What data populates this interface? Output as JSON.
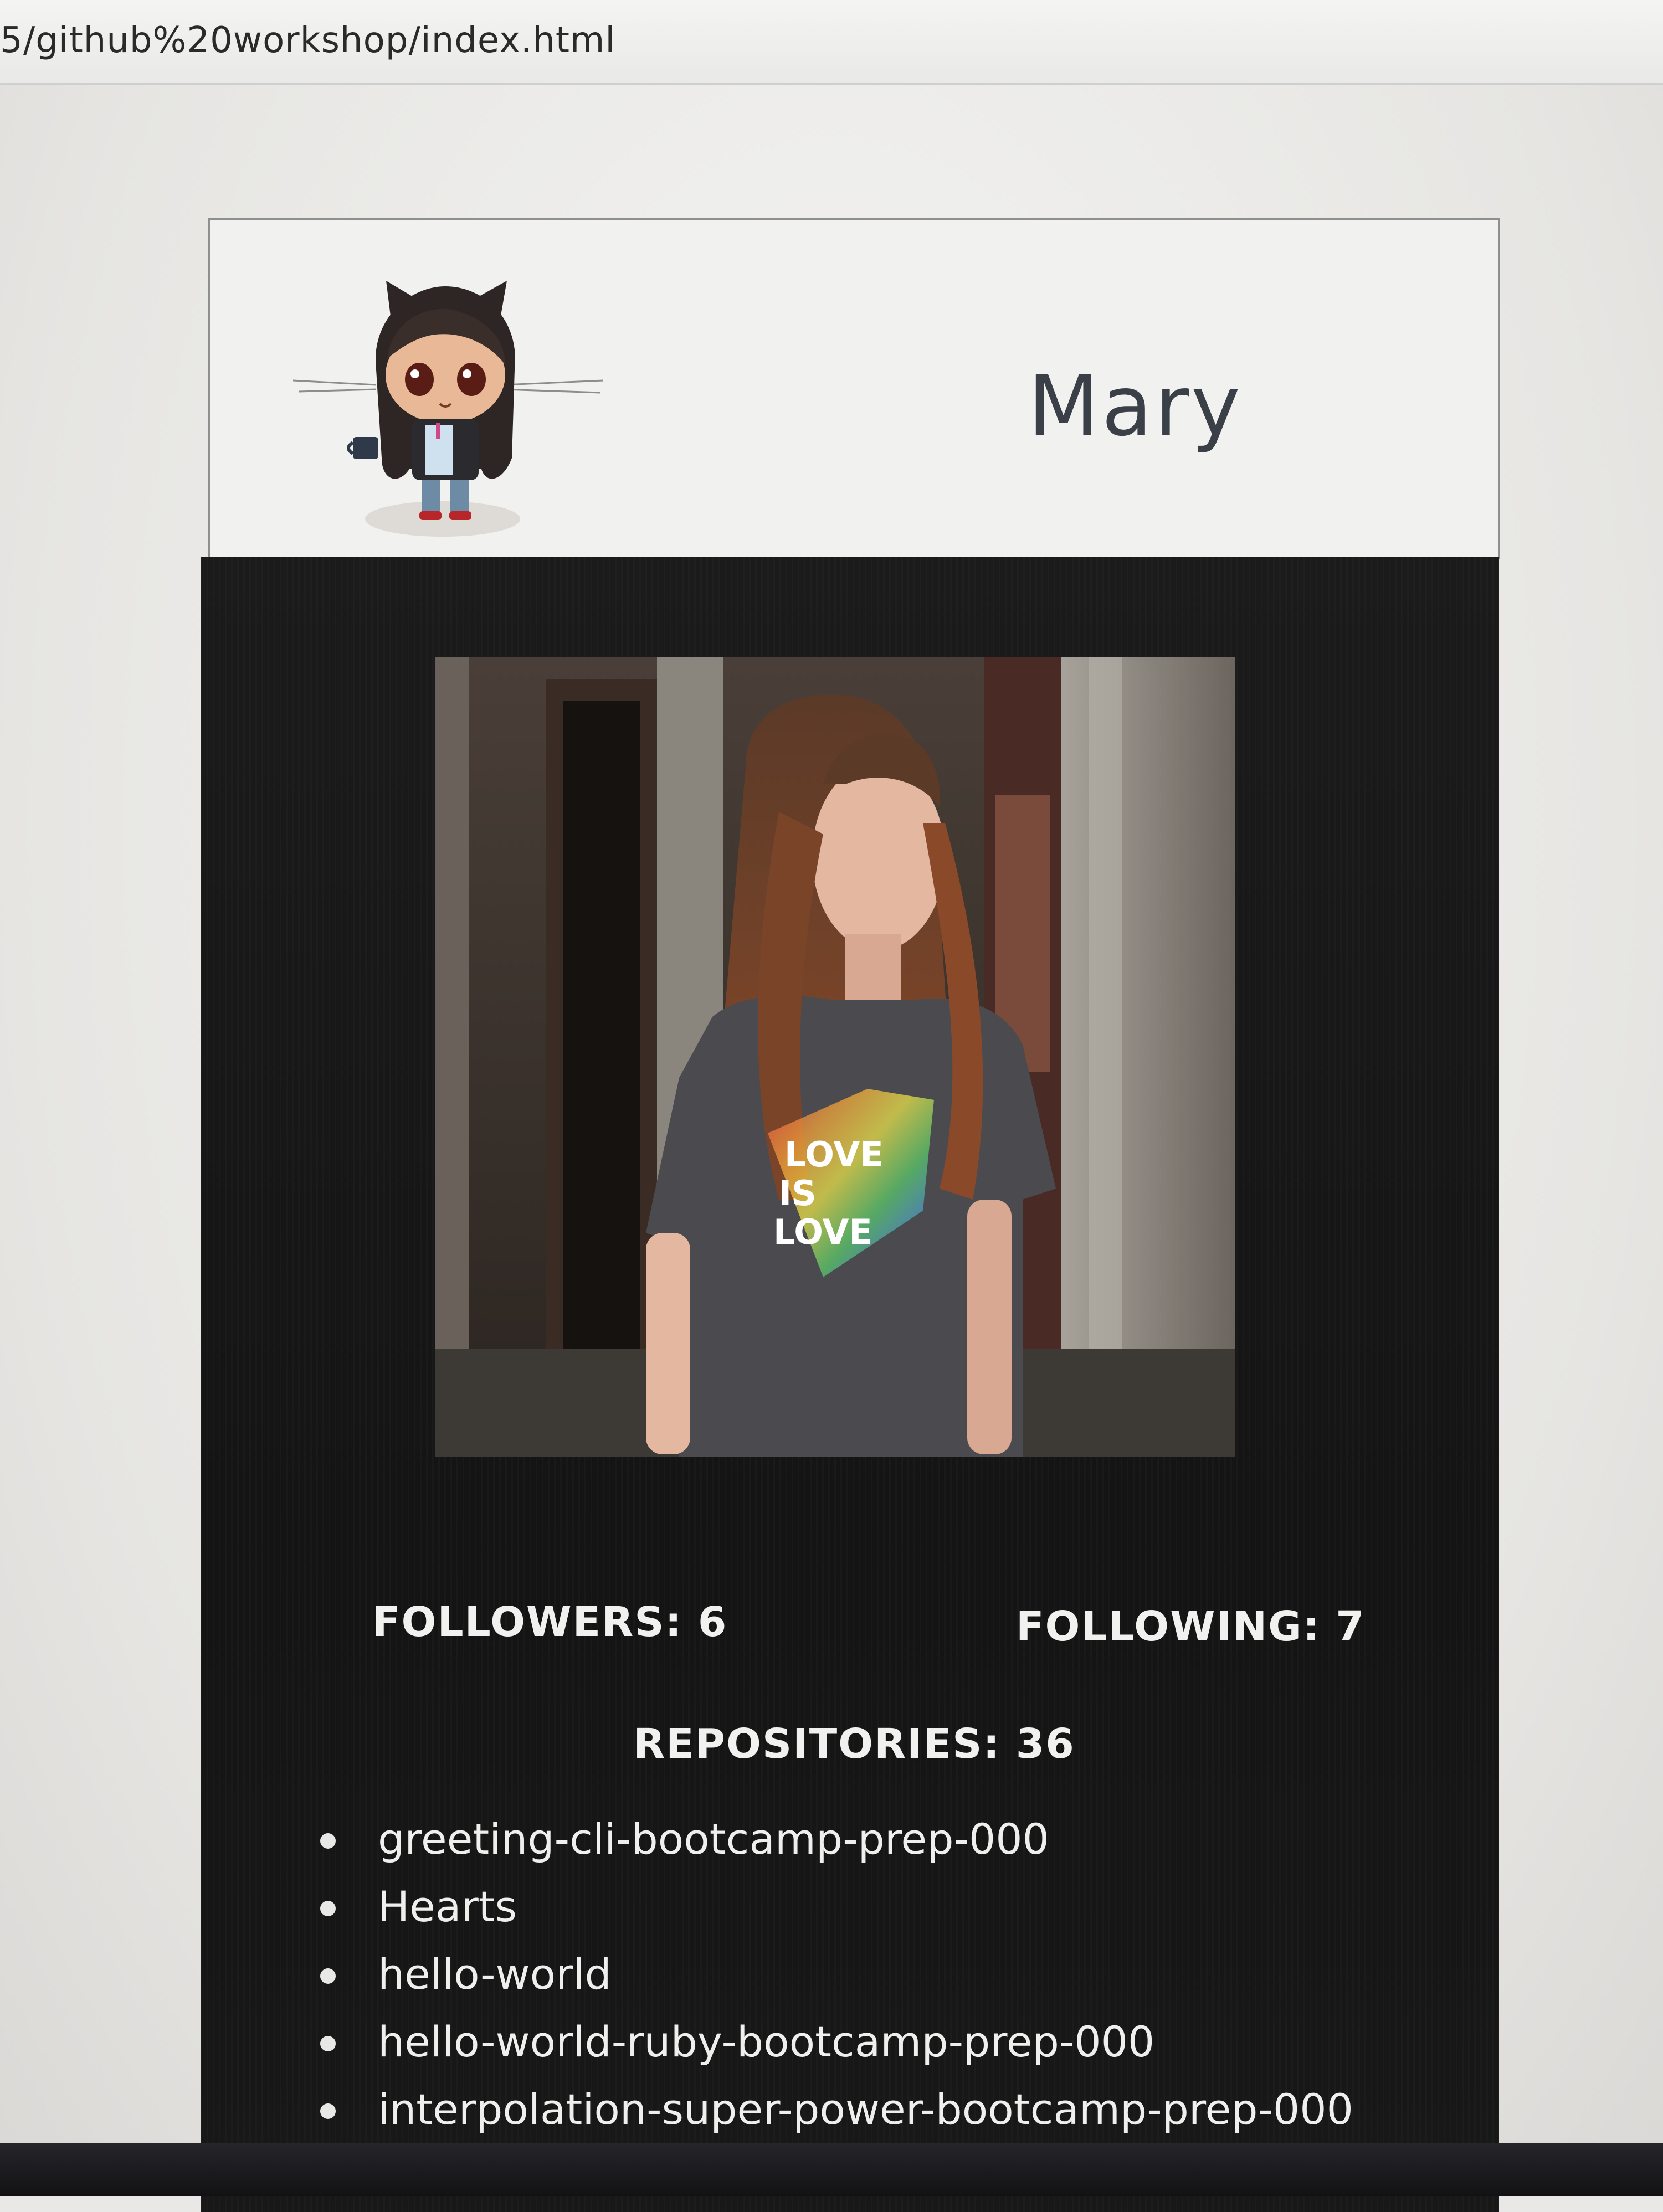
{
  "browser": {
    "url": "5/github%20workshop/index.html"
  },
  "profile": {
    "name": "Mary",
    "avatar_icon": "octocat-icon",
    "photo_shirt_text": "LOVE IS LOVE"
  },
  "stats": {
    "followers_label": "FOLLOWERS: 6",
    "following_label": "FOLLOWING: 7",
    "repositories_label": "REPOSITORIES: 36"
  },
  "repositories": [
    "greeting-cli-bootcamp-prep-000",
    "Hearts",
    "hello-world",
    "hello-world-ruby-bootcamp-prep-000",
    "interpolation-super-power-bootcamp-prep-000"
  ],
  "colors": {
    "header_bg": "#f1f1f0",
    "body_bg": "#161616",
    "name_text": "#3b4048",
    "body_text": "#f1f1ef"
  }
}
